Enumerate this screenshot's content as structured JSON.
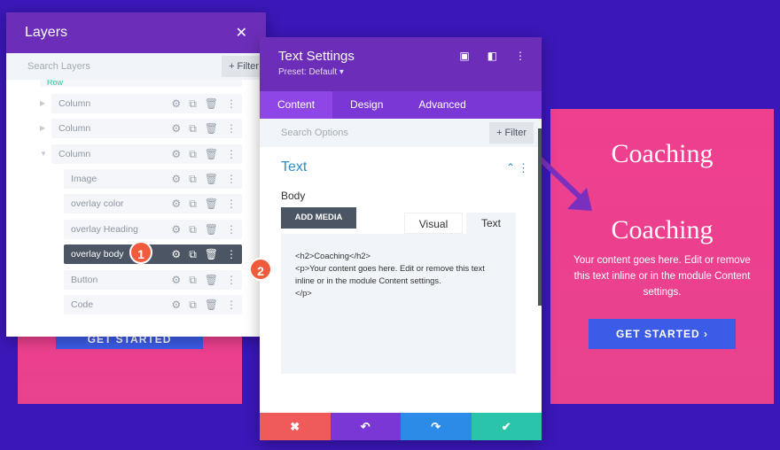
{
  "layers": {
    "title": "Layers",
    "search_placeholder": "Search Layers",
    "filter": "+ Filter",
    "row_label": "Row",
    "items": [
      {
        "label": "Column"
      },
      {
        "label": "Column"
      },
      {
        "label": "Column"
      },
      {
        "label": "Image"
      },
      {
        "label": "overlay color"
      },
      {
        "label": "overlay Heading"
      },
      {
        "label": "overlay body"
      },
      {
        "label": "Button"
      },
      {
        "label": "Code"
      }
    ]
  },
  "settings": {
    "title": "Text Settings",
    "preset": "Preset: Default ▾",
    "tabs": [
      "Content",
      "Design",
      "Advanced"
    ],
    "search_placeholder": "Search Options",
    "filter": "+ Filter",
    "section": "Text",
    "body_label": "Body",
    "add_media": "ADD MEDIA",
    "visual": "Visual",
    "text_tab": "Text",
    "content": "<h2>Coaching</h2>\n<p>Your content goes here. Edit or remove this text inline or in the module Content settings.\n</p>"
  },
  "badges": [
    "1",
    "2"
  ],
  "preview": {
    "heading1": "Coaching",
    "heading2": "Coaching",
    "body": "Your content goes here. Edit or remove this text inline or in the module Content settings.",
    "cta": "GET STARTED ›",
    "left_cta": "GET STARTED"
  },
  "colors": {
    "accent": "#6c2eb9",
    "pink": "#e8428f",
    "button": "#3c5ce8",
    "cancel": "#ef5a5a",
    "undo": "#7b37d6",
    "redo": "#2b8be6",
    "save": "#29c4a9"
  }
}
